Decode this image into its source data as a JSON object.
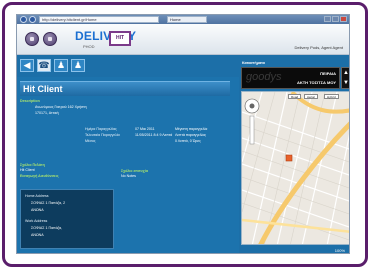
{
  "browser": {
    "address": "http://delivery.hitclient.gr/Home",
    "tab_label": "Home"
  },
  "header": {
    "logo_text": "DELIVERY",
    "logo_sub": "PHOD",
    "hit_badge": "HIT",
    "user_info": "Delivery Pods, Agent Agent"
  },
  "toolbar": {
    "buttons": [
      "arrow-left",
      "phone",
      "person",
      "person"
    ]
  },
  "client": {
    "title": "Hit Client",
    "description_label": "Description",
    "desc_line1": "Ανωνύμους Γιατρού 162 Χρήστη",
    "desc_line2": "170171, Αττική",
    "order_label1": "Ημέρα Παραγγελίας",
    "order_label2": "Τελευταία Παραγγελία",
    "order_label3": "Μέσος",
    "order_val1": "07 Μαι 2011",
    "order_val2": "11/05/2011 8:4 9 Λεπτά",
    "order_val3": "",
    "order_extra1": "Μέγιστη παραγγελία",
    "order_extra2": "Λεπτά παραγγελίας",
    "order_extra3": "0 Λεπτά, 0 Ώρες",
    "notes_label": "Σχόλια Πελάτη",
    "notes_value": "Hit Client",
    "location_label": "Εισαγωγή Διευθύνσεις",
    "extra_label": "Σχόλιο επιτυχία",
    "extra_value": "No Notes"
  },
  "addresses": {
    "home_label": "Home Address",
    "home_line1": "ΣΟΦΙΑΣ 1 Παπάζα, 2",
    "home_line2": "ΑΝΩΝΑ",
    "work_label": "Work Address",
    "work_line1": "ΣΟΦΙΑΣ 1 Παπάζα,",
    "work_line2": "ΑΝΩΝΑ"
  },
  "right_panel": {
    "store_label": "Καταστήματα",
    "store_logo": "goodys",
    "store_line1": "ΠΕΙΡΑΙΑ",
    "store_line2": "ΑΚΤΗ ΤΟΣΙΤΣΑ ΜΟΥ",
    "map_buttons": [
      "Road",
      "Aerial",
      "Hybrid"
    ],
    "map_status": "100%"
  },
  "colors": {
    "main_bg": "#1c6fa8",
    "label_green": "#a7e26f",
    "frame_purple": "#5a1e6b"
  }
}
